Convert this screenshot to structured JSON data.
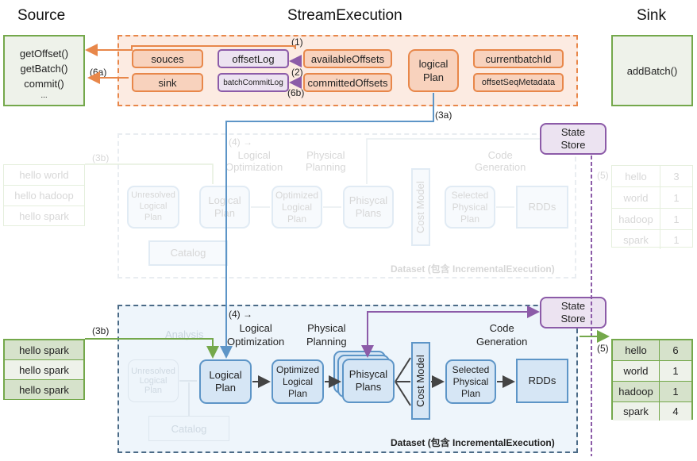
{
  "headers": {
    "source": "Source",
    "stream_execution": "StreamExecution",
    "sink": "Sink"
  },
  "source_box": {
    "methods": [
      "getOffset()",
      "getBatch()",
      "commit()",
      "..."
    ]
  },
  "sink_box": {
    "method": "addBatch()"
  },
  "stream_execution": {
    "fields": {
      "sources": "souces",
      "sink": "sink",
      "offset_log": "offsetLog",
      "batch_commit_log": "batchCommitLog",
      "available_offsets": "availableOffsets",
      "committed_offsets": "committedOffsets",
      "logical_plan": "logical\nPlan",
      "current_batch_id": "currentbatchId",
      "offset_seq_metadata": "offsetSeqMetadata"
    }
  },
  "step_labels": {
    "s1": "(1)",
    "s2": "(2)",
    "s6b": "(6b)",
    "s6a": "(6a)",
    "s3a": "(3a)",
    "s3b": "(3b)",
    "s4": "(4) →",
    "s5": "(5)"
  },
  "pipeline": {
    "analysis": "Analysis",
    "logical_optimization": "Logical\nOptimization",
    "physical_planning": "Physical\nPlanning",
    "code_generation": "Code\nGeneration",
    "unresolved_logical_plan": "Unresolved\nLogical\nPlan",
    "catalog": "Catalog",
    "logical_plan": "Logical\nPlan",
    "optimized_logical_plan": "Optimized\nLogical\nPlan",
    "physical_plans": "Phisycal\nPlans",
    "cost_model": "Cost Model",
    "selected_physical_plan": "Selected\nPhysical\nPlan",
    "rdds": "RDDs",
    "dataset_label": "Dataset (包含 IncrementalExecution)",
    "state_store": "State\nStore"
  },
  "batch_previous": {
    "input_rows": [
      "hello world",
      "hello hadoop",
      "hello spark"
    ],
    "result_rows": [
      {
        "word": "hello",
        "count": "3"
      },
      {
        "word": "world",
        "count": "1"
      },
      {
        "word": "hadoop",
        "count": "1"
      },
      {
        "word": "spark",
        "count": "1"
      }
    ]
  },
  "batch_current": {
    "input_rows": [
      "hello spark",
      "hello spark",
      "hello spark"
    ],
    "result_rows": [
      {
        "word": "hello",
        "count": "6"
      },
      {
        "word": "world",
        "count": "1"
      },
      {
        "word": "hadoop",
        "count": "1"
      },
      {
        "word": "spark",
        "count": "4"
      }
    ]
  },
  "colors": {
    "orange": "#e8874a",
    "purple": "#8c5ba8",
    "blue": "#5d95c7",
    "green": "#74a84b",
    "dark_arrow": "#444444"
  }
}
